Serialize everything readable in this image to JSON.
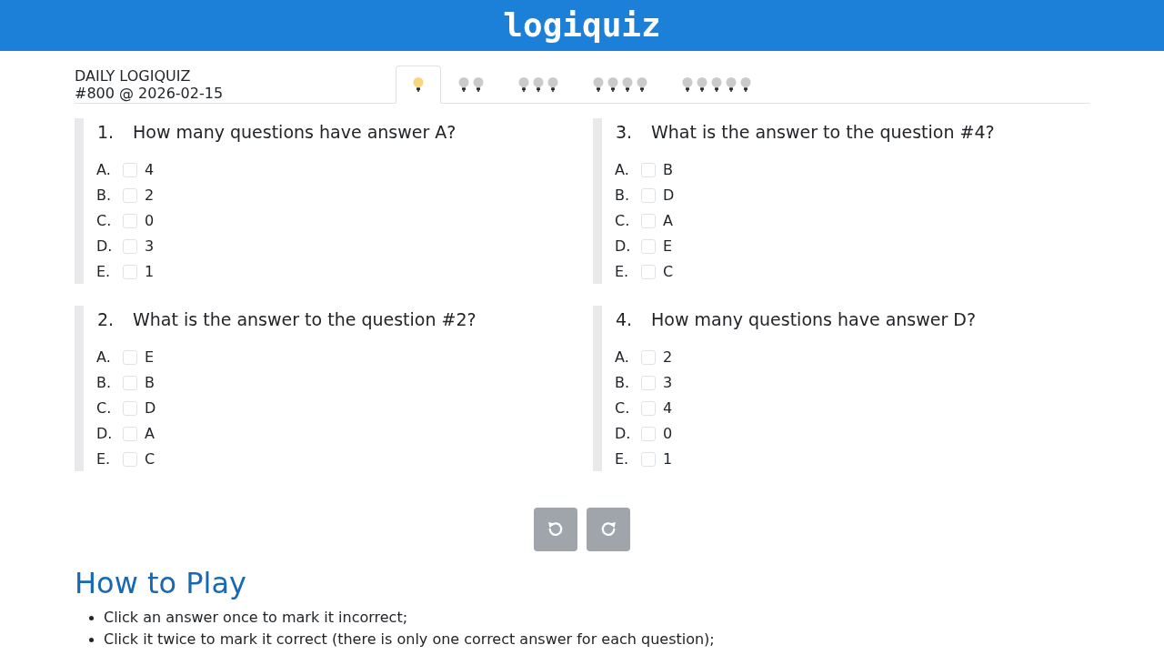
{
  "header": {
    "logo": "logiquiz"
  },
  "puzzle": {
    "title": "DAILY LOGIQUIZ",
    "subtitle": "#800 @ 2026-02-15"
  },
  "tabs": [
    {
      "selected": true,
      "bulbs": [
        {
          "lit": true
        }
      ]
    },
    {
      "selected": false,
      "bulbs": [
        {
          "lit": false
        },
        {
          "lit": false
        }
      ]
    },
    {
      "selected": false,
      "bulbs": [
        {
          "lit": false
        },
        {
          "lit": false
        },
        {
          "lit": false
        }
      ]
    },
    {
      "selected": false,
      "bulbs": [
        {
          "lit": false
        },
        {
          "lit": false
        },
        {
          "lit": false
        },
        {
          "lit": false
        }
      ]
    },
    {
      "selected": false,
      "bulbs": [
        {
          "lit": false
        },
        {
          "lit": false
        },
        {
          "lit": false
        },
        {
          "lit": false
        },
        {
          "lit": false
        }
      ]
    }
  ],
  "questions": [
    {
      "number": "1.",
      "text": "How many questions have answer A?",
      "options": [
        {
          "letter": "A.",
          "answer": "4",
          "checked": false
        },
        {
          "letter": "B.",
          "answer": "2",
          "checked": false
        },
        {
          "letter": "C.",
          "answer": "0",
          "checked": false
        },
        {
          "letter": "D.",
          "answer": "3",
          "checked": false
        },
        {
          "letter": "E.",
          "answer": "1",
          "checked": false
        }
      ]
    },
    {
      "number": "2.",
      "text": "What is the answer to the question #2?",
      "options": [
        {
          "letter": "A.",
          "answer": "E",
          "checked": false
        },
        {
          "letter": "B.",
          "answer": "B",
          "checked": false
        },
        {
          "letter": "C.",
          "answer": "D",
          "checked": false
        },
        {
          "letter": "D.",
          "answer": "A",
          "checked": false
        },
        {
          "letter": "E.",
          "answer": "C",
          "checked": false
        }
      ]
    },
    {
      "number": "3.",
      "text": "What is the answer to the question #4?",
      "options": [
        {
          "letter": "A.",
          "answer": "B",
          "checked": false
        },
        {
          "letter": "B.",
          "answer": "D",
          "checked": false
        },
        {
          "letter": "C.",
          "answer": "A",
          "checked": false
        },
        {
          "letter": "D.",
          "answer": "E",
          "checked": false
        },
        {
          "letter": "E.",
          "answer": "C",
          "checked": false
        }
      ]
    },
    {
      "number": "4.",
      "text": "How many questions have answer D?",
      "options": [
        {
          "letter": "A.",
          "answer": "2",
          "checked": false
        },
        {
          "letter": "B.",
          "answer": "3",
          "checked": false
        },
        {
          "letter": "C.",
          "answer": "4",
          "checked": false
        },
        {
          "letter": "D.",
          "answer": "0",
          "checked": false
        },
        {
          "letter": "E.",
          "answer": "1",
          "checked": false
        }
      ]
    }
  ],
  "controls": [
    {
      "kind": "undo"
    },
    {
      "kind": "redo"
    }
  ],
  "how_to_play": {
    "heading": "How to Play",
    "items": [
      "Click an answer once to mark it incorrect;",
      "Click it twice to mark it correct (there is only one correct answer for each question);"
    ]
  }
}
